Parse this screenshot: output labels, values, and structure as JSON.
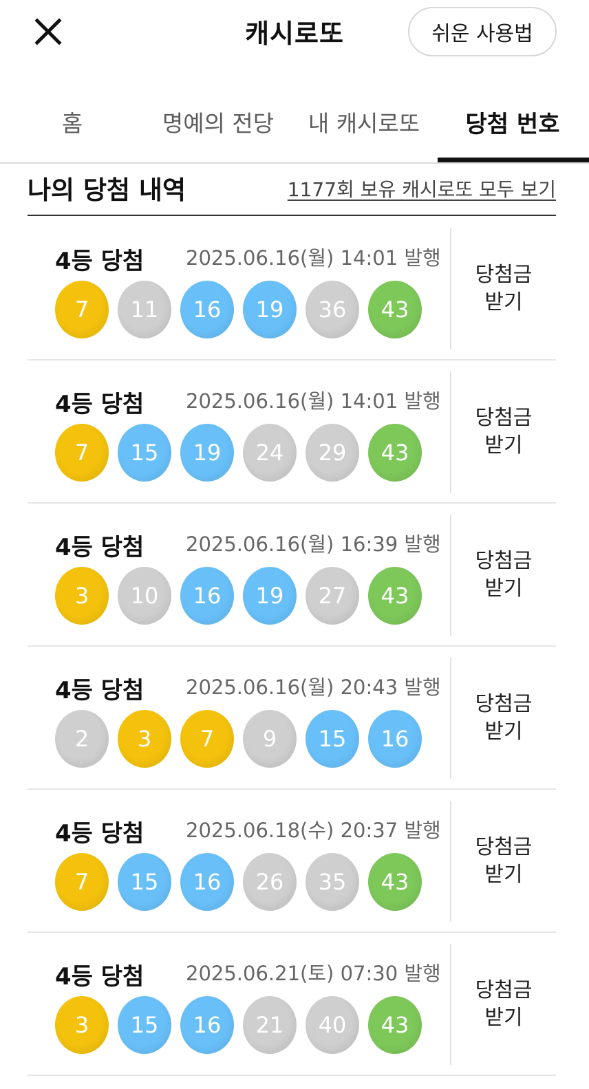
{
  "header": {
    "title": "캐시로또",
    "guide_label": "쉬운 사용법",
    "close_icon": "close-icon"
  },
  "tabs": [
    {
      "label": "홈",
      "active": false
    },
    {
      "label": "명예의 전당",
      "active": false
    },
    {
      "label": "내 캐시로또",
      "active": false
    },
    {
      "label": "당첨 번호",
      "active": true
    }
  ],
  "section": {
    "title": "나의 당첨 내역",
    "view_all_link": "1177회 보유 캐시로또 모두 보기"
  },
  "colors": {
    "yellow": "#f4c20d",
    "gray": "#cfcfcf",
    "blue": "#69c0f9",
    "green": "#7ec85a"
  },
  "prizes": [
    {
      "rank": "4등 당첨",
      "date": "2025.06.16(월) 14:01 발행",
      "claim_line1": "당첨금",
      "claim_line2": "받기",
      "balls": [
        {
          "number": "7",
          "color": "yellow"
        },
        {
          "number": "11",
          "color": "gray"
        },
        {
          "number": "16",
          "color": "blue"
        },
        {
          "number": "19",
          "color": "blue"
        },
        {
          "number": "36",
          "color": "gray"
        },
        {
          "number": "43",
          "color": "green"
        }
      ]
    },
    {
      "rank": "4등 당첨",
      "date": "2025.06.16(월) 14:01 발행",
      "claim_line1": "당첨금",
      "claim_line2": "받기",
      "balls": [
        {
          "number": "7",
          "color": "yellow"
        },
        {
          "number": "15",
          "color": "blue"
        },
        {
          "number": "19",
          "color": "blue"
        },
        {
          "number": "24",
          "color": "gray"
        },
        {
          "number": "29",
          "color": "gray"
        },
        {
          "number": "43",
          "color": "green"
        }
      ]
    },
    {
      "rank": "4등 당첨",
      "date": "2025.06.16(월) 16:39 발행",
      "claim_line1": "당첨금",
      "claim_line2": "받기",
      "balls": [
        {
          "number": "3",
          "color": "yellow"
        },
        {
          "number": "10",
          "color": "gray"
        },
        {
          "number": "16",
          "color": "blue"
        },
        {
          "number": "19",
          "color": "blue"
        },
        {
          "number": "27",
          "color": "gray"
        },
        {
          "number": "43",
          "color": "green"
        }
      ]
    },
    {
      "rank": "4등 당첨",
      "date": "2025.06.16(월) 20:43 발행",
      "claim_line1": "당첨금",
      "claim_line2": "받기",
      "balls": [
        {
          "number": "2",
          "color": "gray"
        },
        {
          "number": "3",
          "color": "yellow"
        },
        {
          "number": "7",
          "color": "yellow"
        },
        {
          "number": "9",
          "color": "gray"
        },
        {
          "number": "15",
          "color": "blue"
        },
        {
          "number": "16",
          "color": "blue"
        }
      ]
    },
    {
      "rank": "4등 당첨",
      "date": "2025.06.18(수) 20:37 발행",
      "claim_line1": "당첨금",
      "claim_line2": "받기",
      "balls": [
        {
          "number": "7",
          "color": "yellow"
        },
        {
          "number": "15",
          "color": "blue"
        },
        {
          "number": "16",
          "color": "blue"
        },
        {
          "number": "26",
          "color": "gray"
        },
        {
          "number": "35",
          "color": "gray"
        },
        {
          "number": "43",
          "color": "green"
        }
      ]
    },
    {
      "rank": "4등 당첨",
      "date": "2025.06.21(토) 07:30 발행",
      "claim_line1": "당첨금",
      "claim_line2": "받기",
      "balls": [
        {
          "number": "3",
          "color": "yellow"
        },
        {
          "number": "15",
          "color": "blue"
        },
        {
          "number": "16",
          "color": "blue"
        },
        {
          "number": "21",
          "color": "gray"
        },
        {
          "number": "40",
          "color": "gray"
        },
        {
          "number": "43",
          "color": "green"
        }
      ]
    }
  ]
}
